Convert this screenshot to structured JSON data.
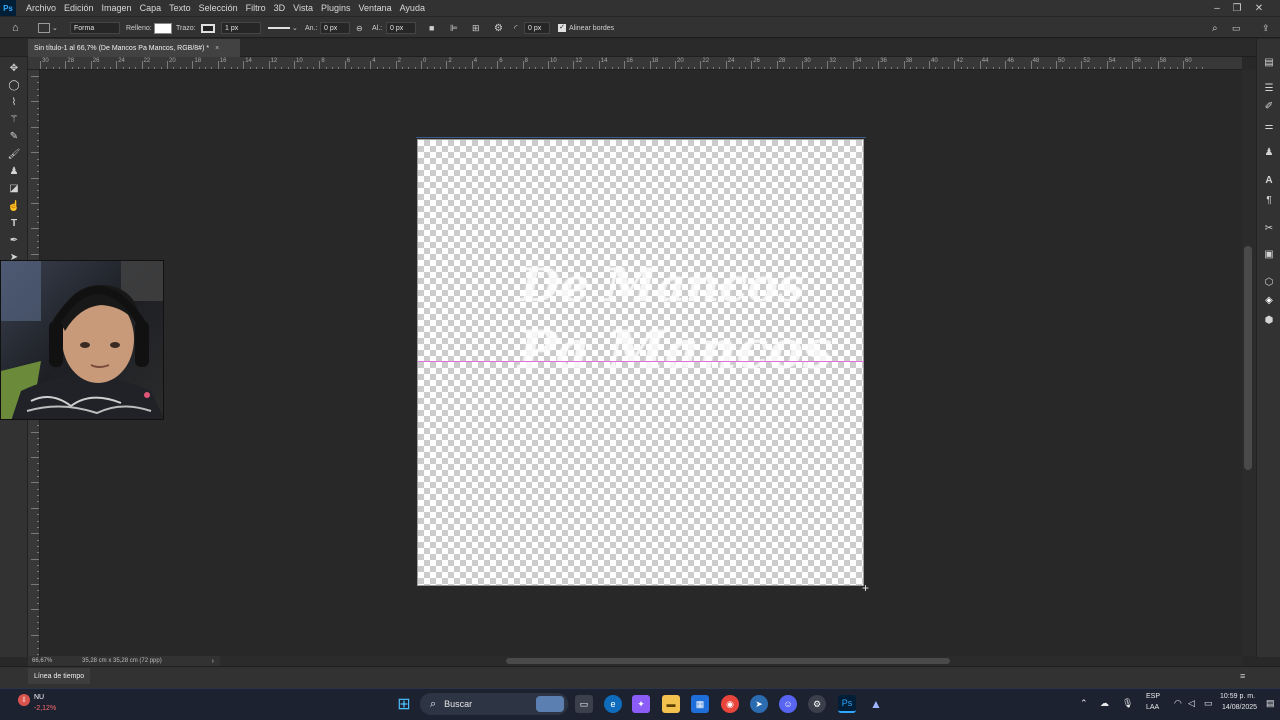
{
  "app": {
    "logo": "Ps"
  },
  "menu": [
    "Archivo",
    "Edición",
    "Imagen",
    "Capa",
    "Texto",
    "Selección",
    "Filtro",
    "3D",
    "Vista",
    "Plugins",
    "Ventana",
    "Ayuda"
  ],
  "options": {
    "mode": "Forma",
    "fill_label": "Relleno:",
    "stroke_label": "Trazo:",
    "stroke_width": "1 px",
    "width_label": "An.:",
    "width_value": "0 px",
    "height_label": "Al.:",
    "height_value": "0 px",
    "radius_value": "0 px",
    "align_edges": "Alinear bordes"
  },
  "document": {
    "tab_title": "Sin título-1 al 66,7% (De Mancos  Pa Mancos, RGB/8#) *",
    "close": "×"
  },
  "canvas_text": {
    "line1": "De Mancos",
    "line2": "Pa Mancos"
  },
  "ruler_top_labels": [
    "30",
    "28",
    "26",
    "24",
    "22",
    "20",
    "18",
    "16",
    "14",
    "12",
    "10",
    "8",
    "6",
    "4",
    "2",
    "0",
    "2",
    "4",
    "6",
    "8",
    "10",
    "12",
    "14",
    "16",
    "18",
    "20",
    "22",
    "24",
    "26",
    "28",
    "30",
    "32",
    "34",
    "36",
    "38",
    "40",
    "42",
    "44",
    "46",
    "48",
    "50",
    "52",
    "54",
    "56",
    "58",
    "60"
  ],
  "status": {
    "zoom": "66,67%",
    "doc_size": "35,28 cm x 35,28 cm (72 ppp)"
  },
  "timeline": {
    "tab": "Línea de tiempo"
  },
  "taskbar": {
    "search": "Buscar",
    "weather_title": "NU",
    "weather_value": "-2,12%",
    "lang_top": "ESP",
    "lang_bottom": "LAA",
    "time": "10:59 p. m.",
    "date": "14/08/2025"
  },
  "colors": {
    "accent": "#31a8ff",
    "guide": "#e070e0",
    "taskbar": "#1c2230"
  },
  "icons": {
    "tools": [
      "move-icon",
      "lasso-icon",
      "polygonal-lasso-icon",
      "magic-wand-icon",
      "eyedropper-icon",
      "brush-icon",
      "stamp-icon",
      "eraser-icon",
      "smudge-icon",
      "text-icon",
      "pen-icon",
      "path-select-icon"
    ],
    "panels": [
      "library-icon",
      "adjustments-icon",
      "brush-settings-icon",
      "properties-icon",
      "character-icon",
      "paragraph-icon",
      "tools-preset-icon",
      "channels-icon",
      "3d-icon",
      "layers-icon",
      "paths-icon"
    ]
  }
}
